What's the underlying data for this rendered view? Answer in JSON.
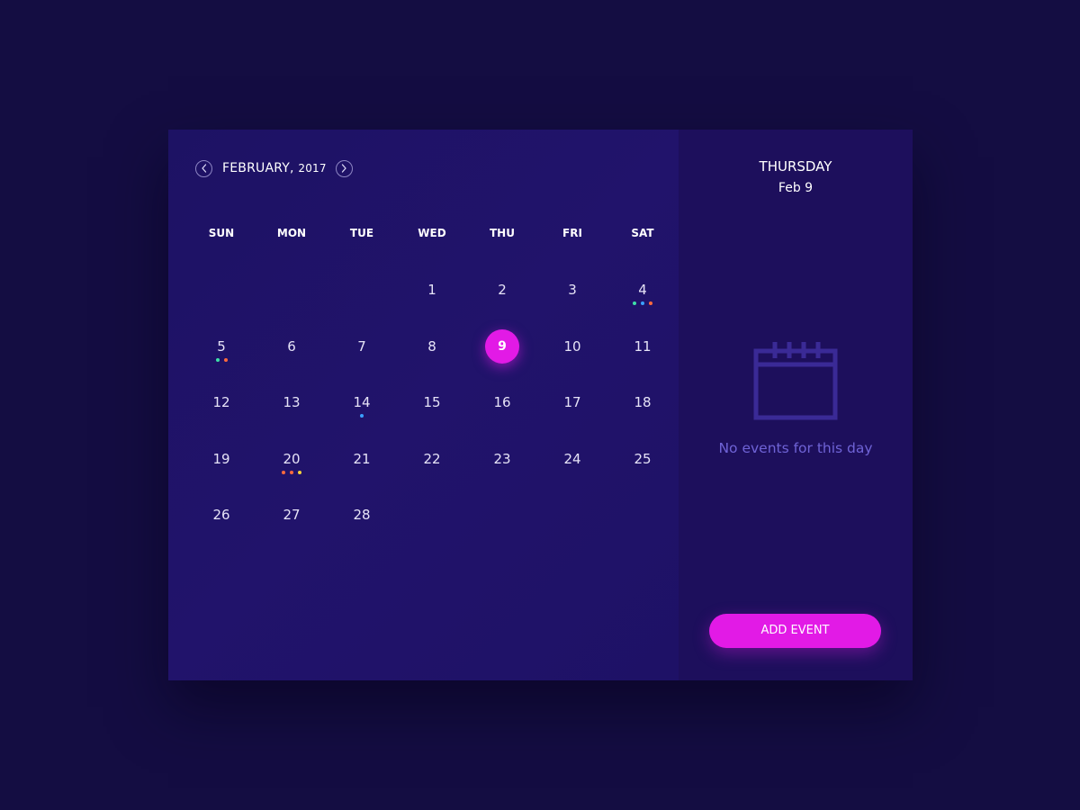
{
  "calendar": {
    "month_label": "FEBRUARY,",
    "year_label": "2017",
    "prev_icon": "chevron-left-icon",
    "next_icon": "chevron-right-icon",
    "weekdays": [
      "SUN",
      "MON",
      "TUE",
      "WED",
      "THU",
      "FRI",
      "SAT"
    ],
    "weeks": [
      [
        {
          "day": ""
        },
        {
          "day": ""
        },
        {
          "day": ""
        },
        {
          "day": "1"
        },
        {
          "day": "2"
        },
        {
          "day": "3"
        },
        {
          "day": "4",
          "dots": [
            "#3ee0a8",
            "#3aa0ff",
            "#ff6a3d"
          ]
        }
      ],
      [
        {
          "day": "5",
          "dots": [
            "#3ee0a8",
            "#ff6a3d"
          ]
        },
        {
          "day": "6"
        },
        {
          "day": "7"
        },
        {
          "day": "8"
        },
        {
          "day": "9",
          "selected": true
        },
        {
          "day": "10"
        },
        {
          "day": "11"
        }
      ],
      [
        {
          "day": "12"
        },
        {
          "day": "13"
        },
        {
          "day": "14",
          "dots": [
            "#3aa0ff"
          ]
        },
        {
          "day": "15"
        },
        {
          "day": "16"
        },
        {
          "day": "17"
        },
        {
          "day": "18"
        }
      ],
      [
        {
          "day": "19"
        },
        {
          "day": "20",
          "dots": [
            "#ff6a3d",
            "#ff6a3d",
            "#f5d23a"
          ]
        },
        {
          "day": "21"
        },
        {
          "day": "22"
        },
        {
          "day": "23"
        },
        {
          "day": "24"
        },
        {
          "day": "25"
        }
      ],
      [
        {
          "day": "26"
        },
        {
          "day": "27"
        },
        {
          "day": "28"
        }
      ]
    ]
  },
  "side": {
    "day_name": "THURSDAY",
    "date": "Feb 9",
    "empty_icon": "calendar-icon",
    "empty_text": "No events for this day",
    "add_button_label": "ADD EVENT"
  },
  "colors": {
    "background": "#140d42",
    "calendar_panel": "#1f1267",
    "side_panel": "#1d0f5c",
    "accent": "#e21ae6",
    "muted_text": "#6f63d6"
  }
}
